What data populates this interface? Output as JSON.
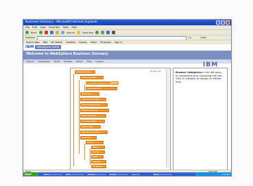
{
  "window": {
    "title": "Business Glossary - Microsoft Internet Explorer"
  },
  "menu": [
    "File",
    "Edit",
    "View",
    "Favorites",
    "Tools",
    "Help"
  ],
  "toolbar": {
    "back_label": "Back",
    "search_label": "Search",
    "favorites_label": "Favorites"
  },
  "address": {
    "label": "Address",
    "go_label": "Go",
    "links_label": "Links"
  },
  "links_items": [
    "Search Web",
    "Mail",
    "My Yahoo!",
    "Answers",
    "Games",
    "Music",
    "Personals",
    "Sign In"
  ],
  "ibm": {
    "logo": "IBM",
    "tab": "WebSphere Portal"
  },
  "banner": {
    "title": "Welcome to WebSphere Business Glossary"
  },
  "subnav": [
    "Search",
    "Categories",
    "Terms",
    "Browse",
    "Admin",
    "Help",
    "Logout"
  ],
  "tree": {
    "header": "Expand All",
    "nodes": [
      {
        "label": "Business Glossary"
      },
      {
        "label": "Financial Services"
      },
      {
        "label": "Banking & Financial Markets"
      },
      {
        "label": "Insurance & Risk"
      },
      {
        "label": "Accounting"
      },
      {
        "label": "Customer Information"
      },
      {
        "label": "Customer Relationship"
      },
      {
        "label": "Products & Services"
      },
      {
        "label": "Sales & Marketing"
      },
      {
        "label": "Corporate Actions"
      },
      {
        "label": "Legal Entities"
      },
      {
        "label": "Regulatory Reporting"
      },
      {
        "label": "Healthcare"
      },
      {
        "label": "Clinical"
      },
      {
        "label": "Patient"
      },
      {
        "label": "Provider"
      },
      {
        "label": "Claims"
      },
      {
        "label": "Diagnosis"
      },
      {
        "label": "Procedures"
      },
      {
        "label": "Pharmacy"
      },
      {
        "label": "Retail"
      },
      {
        "label": "Telecom"
      }
    ]
  },
  "info": {
    "heading": "Browse Categories",
    "text": " In the left pane, try expanding and collapsing the tree. Click a Category to display its details here."
  },
  "status": {
    "left": "Done",
    "right": "Internet"
  },
  "taskbar": {
    "start_label": "start",
    "tasks": [
      "Inbox",
      "Doc1",
      "Glossary",
      "Eclipse",
      "Business",
      "Notes"
    ],
    "tray_time": "4:33 PM"
  }
}
